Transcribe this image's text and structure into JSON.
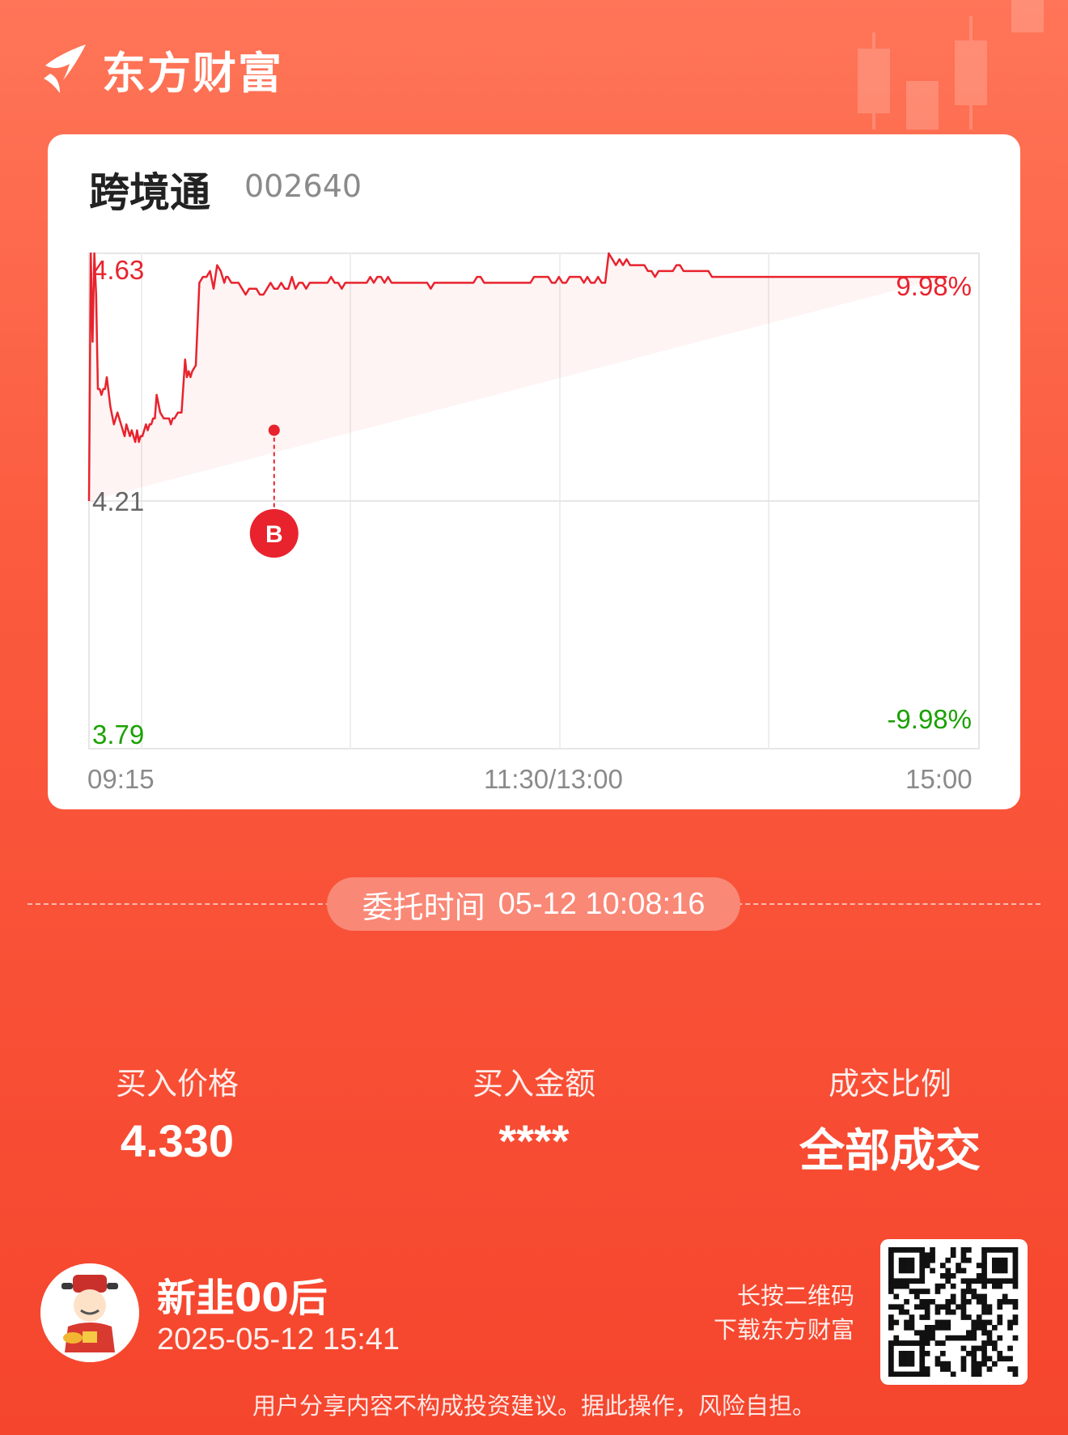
{
  "brand": {
    "name": "东方财富"
  },
  "stock": {
    "name": "跨境通",
    "code": "002640"
  },
  "chart_data": {
    "type": "line",
    "y_ticks": {
      "top": "4.63",
      "mid": "4.21",
      "bottom": "3.79"
    },
    "pct_labels": {
      "top": "9.98%",
      "bottom": "-9.98%"
    },
    "x_ticks": [
      "09:15",
      "11:30/13:00",
      "15:00"
    ],
    "ylim": [
      3.79,
      4.63
    ],
    "prev_close": 4.21,
    "x": [
      0,
      1,
      2,
      3,
      4,
      5,
      6,
      7,
      8,
      9,
      10,
      12,
      14,
      16,
      18,
      20,
      21,
      22,
      23,
      24,
      25,
      26,
      27,
      28,
      29,
      30,
      31,
      32,
      33,
      34,
      35,
      36,
      37,
      38,
      40,
      42,
      45,
      46,
      47,
      48,
      50,
      52,
      54,
      55,
      56,
      57,
      58,
      60,
      62,
      64,
      66,
      68,
      70,
      72,
      74,
      76,
      77,
      78,
      80,
      82,
      84,
      86,
      88,
      90,
      92,
      94,
      96,
      98,
      100,
      102,
      104,
      106,
      108,
      110,
      112,
      114,
      116,
      118,
      120,
      122,
      124,
      126,
      128,
      130,
      132,
      134,
      136,
      138,
      140,
      142,
      144,
      146,
      148,
      150,
      152,
      154,
      156,
      158,
      160,
      162,
      164,
      166,
      168,
      170,
      172,
      174,
      176,
      178,
      180,
      182,
      184,
      186,
      188,
      190,
      192,
      194,
      196,
      198,
      200,
      202,
      204,
      206,
      208,
      210,
      212,
      214,
      216,
      218,
      220,
      222,
      224,
      226,
      228,
      230,
      232,
      234,
      236,
      238,
      240,
      242,
      244,
      246,
      248,
      250,
      252,
      254,
      256,
      258,
      260,
      262,
      264,
      266,
      268,
      270,
      272,
      274,
      276,
      278,
      280,
      282,
      284,
      286,
      288,
      290,
      292,
      294,
      296,
      298,
      300,
      302,
      304,
      306,
      308,
      310,
      312,
      314,
      316,
      318,
      320,
      322,
      324,
      326,
      328,
      330,
      332,
      334,
      336,
      338,
      340,
      342,
      344,
      346,
      348,
      350,
      352,
      354,
      356,
      358,
      360,
      362,
      364,
      366,
      368,
      370,
      372,
      374,
      376,
      378,
      380,
      382,
      384,
      386,
      388,
      390,
      392,
      394,
      396,
      398,
      400,
      402,
      404,
      406,
      408,
      410,
      412,
      414,
      416,
      418,
      420,
      422,
      424,
      426,
      428,
      430,
      432,
      434,
      436,
      438,
      440,
      442,
      444,
      446,
      448,
      450,
      452,
      454,
      456,
      458,
      460,
      462,
      464,
      466,
      468,
      470,
      472,
      474,
      476,
      478,
      480,
      482,
      484,
      486,
      488,
      490,
      492,
      494,
      496,
      498,
      500
    ],
    "values": [
      4.21,
      4.63,
      4.48,
      4.63,
      4.56,
      4.4,
      4.4,
      4.39,
      4.4,
      4.4,
      4.42,
      4.37,
      4.34,
      4.36,
      4.34,
      4.32,
      4.34,
      4.33,
      4.32,
      4.33,
      4.32,
      4.31,
      4.33,
      4.31,
      4.32,
      4.32,
      4.33,
      4.34,
      4.33,
      4.34,
      4.34,
      4.35,
      4.35,
      4.39,
      4.36,
      4.35,
      4.35,
      4.34,
      4.35,
      4.35,
      4.36,
      4.36,
      4.45,
      4.42,
      4.43,
      4.42,
      4.43,
      4.44,
      4.58,
      4.59,
      4.59,
      4.6,
      4.57,
      4.61,
      4.6,
      4.58,
      4.59,
      4.59,
      4.58,
      4.58,
      4.58,
      4.57,
      4.56,
      4.57,
      4.57,
      4.57,
      4.56,
      4.56,
      4.57,
      4.58,
      4.57,
      4.57,
      4.58,
      4.57,
      4.57,
      4.59,
      4.57,
      4.58,
      4.58,
      4.57,
      4.58,
      4.58,
      4.58,
      4.58,
      4.58,
      4.58,
      4.59,
      4.58,
      4.58,
      4.57,
      4.58,
      4.58,
      4.58,
      4.58,
      4.58,
      4.58,
      4.58,
      4.59,
      4.58,
      4.59,
      4.59,
      4.58,
      4.59,
      4.58,
      4.58,
      4.58,
      4.58,
      4.58,
      4.58,
      4.58,
      4.58,
      4.58,
      4.58,
      4.58,
      4.57,
      4.58,
      4.58,
      4.58,
      4.58,
      4.58,
      4.58,
      4.58,
      4.58,
      4.58,
      4.58,
      4.58,
      4.58,
      4.59,
      4.59,
      4.58,
      4.58,
      4.58,
      4.58,
      4.58,
      4.58,
      4.58,
      4.58,
      4.58,
      4.58,
      4.58,
      4.58,
      4.58,
      4.58,
      4.59,
      4.59,
      4.59,
      4.59,
      4.59,
      4.58,
      4.58,
      4.59,
      4.58,
      4.58,
      4.59,
      4.59,
      4.59,
      4.59,
      4.58,
      4.59,
      4.58,
      4.58,
      4.59,
      4.58,
      4.58,
      4.63,
      4.62,
      4.61,
      4.62,
      4.61,
      4.62,
      4.61,
      4.61,
      4.61,
      4.61,
      4.61,
      4.6,
      4.6,
      4.59,
      4.6,
      4.6,
      4.6,
      4.6,
      4.6,
      4.61,
      4.61,
      4.6,
      4.6,
      4.6,
      4.6,
      4.6,
      4.6,
      4.6,
      4.6,
      4.59,
      4.59,
      4.59,
      4.59,
      4.59,
      4.59,
      4.59,
      4.59,
      4.59,
      4.59,
      4.59,
      4.59,
      4.59,
      4.59,
      4.59,
      4.59,
      4.59,
      4.59,
      4.59,
      4.59,
      4.59,
      4.59,
      4.59,
      4.59,
      4.59,
      4.59,
      4.59,
      4.59,
      4.59,
      4.59,
      4.59,
      4.59,
      4.59,
      4.59,
      4.59,
      4.59,
      4.59,
      4.59,
      4.59,
      4.59,
      4.59,
      4.59,
      4.59,
      4.59,
      4.59,
      4.59,
      4.59,
      4.59,
      4.59,
      4.59,
      4.59,
      4.59,
      4.59,
      4.59,
      4.59,
      4.59,
      4.59,
      4.59,
      4.59,
      4.59,
      4.59,
      4.59,
      4.59,
      4.59,
      4.59,
      4.59,
      4.59
    ],
    "marker": {
      "label": "B",
      "x": 104,
      "value": 4.33
    },
    "colors": {
      "line": "#e8232d",
      "up": "#e8232d",
      "down": "#1aa100",
      "neutral": "#666666"
    }
  },
  "order": {
    "time_label": "委托时间",
    "time_value": "05-12 10:08:16"
  },
  "stats": [
    {
      "label": "买入价格",
      "value": "4.330"
    },
    {
      "label": "买入金额",
      "value": "****"
    },
    {
      "label": "成交比例",
      "value": "全部成交"
    }
  ],
  "user": {
    "name": "新韭00后",
    "time": "2025-05-12 15:41"
  },
  "qr_hint": {
    "line1": "长按二维码",
    "line2": "下载东方财富"
  },
  "disclaimer": "用户分享内容不构成投资建议。据此操作，风险自担。"
}
